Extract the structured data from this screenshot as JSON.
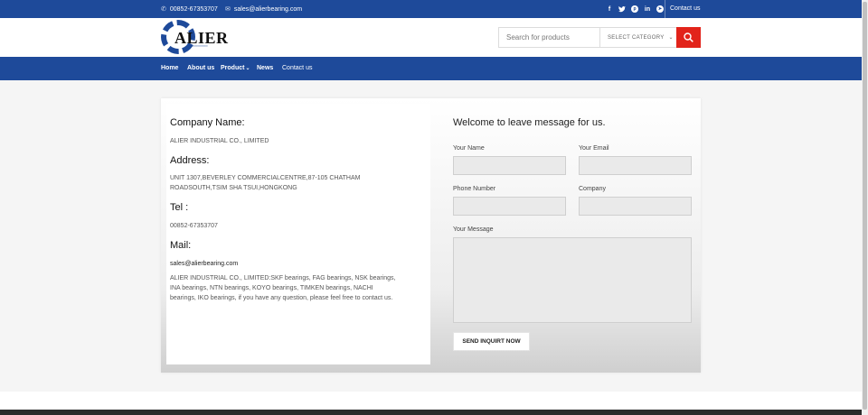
{
  "topbar": {
    "phone": "00852-67353707",
    "email": "sales@alierbearing.com",
    "contact_label": "Contact us",
    "social_icons": [
      "facebook-icon",
      "twitter-icon",
      "pinterest-icon",
      "linkedin-icon",
      "telegram-icon"
    ]
  },
  "header": {
    "logo_text": "ALIER",
    "search_placeholder": "Search for products",
    "category_label": "SELECT CATEGORY"
  },
  "nav": {
    "items": [
      "Home",
      "About us",
      "Product",
      "News",
      "Contact us"
    ]
  },
  "info": {
    "company_heading": "Company Name:",
    "company_value": "ALIER INDUSTRIAL CO., LIMITED",
    "address_heading": "Address:",
    "address_value": "UNIT 1307,BEVERLEY COMMERCIALCENTRE,87-105 CHATHAM ROADSOUTH,TSIM SHA TSUI,HONGKONG",
    "tel_heading": "Tel :",
    "tel_value": "00852-67353707",
    "mail_heading": "Mail:",
    "mail_value": "sales@alierbearing.com",
    "description": "ALIER INDUSTRIAL CO., LIMITED:SKF bearings, FAG bearings, NSK bearings, INA bearings, NTN bearings, KOYO bearings, TIMKEN bearings, NACHI bearings, IKO bearings, if you have any question, please feel free to contact us."
  },
  "form": {
    "title": "Welcome to leave message for us.",
    "name_label": "Your Name",
    "email_label": "Your Email",
    "phone_label": "Phone Number",
    "company_label": "Company",
    "message_label": "Your Message",
    "submit_label": "SEND INQUIRT NOW"
  },
  "colors": {
    "brand_blue": "#1e4a9a",
    "search_red": "#e2231a"
  }
}
